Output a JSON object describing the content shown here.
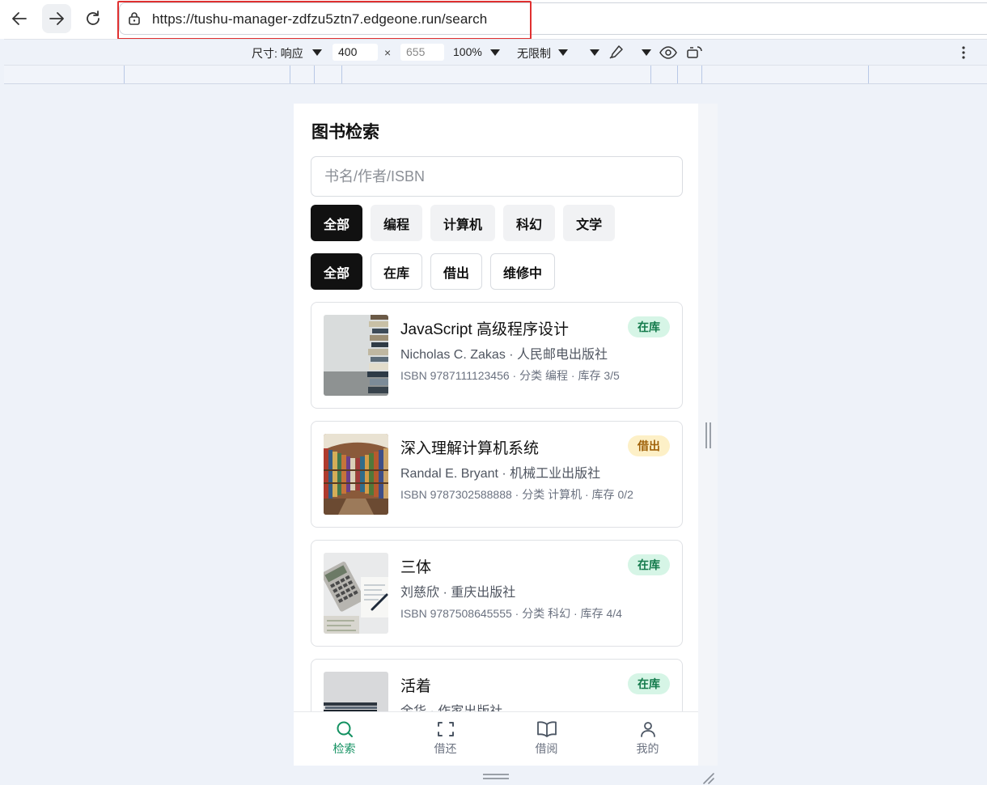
{
  "browser": {
    "url": "https://tushu-manager-zdfzu5ztn7.edgeone.run/search",
    "device_toolbar": {
      "size_label": "尺寸: 响应",
      "width": "400",
      "times": "×",
      "height": "655",
      "zoom": "100%",
      "throttle": "无限制"
    }
  },
  "page": {
    "title": "图书检索",
    "search_placeholder": "书名/作者/ISBN",
    "categories": [
      "全部",
      "编程",
      "计算机",
      "科幻",
      "文学"
    ],
    "active_category": "全部",
    "statuses": [
      "全部",
      "在库",
      "借出",
      "维修中"
    ],
    "active_status": "全部"
  },
  "books": [
    {
      "title": "JavaScript 高级程序设计",
      "subtitle": "Nicholas C. Zakas · 人民邮电出版社",
      "meta": "ISBN 9787111123456 · 分类 编程 · 库存 3/5",
      "status": "在库",
      "status_color": "#137a4b"
    },
    {
      "title": "深入理解计算机系统",
      "subtitle": "Randal E. Bryant · 机械工业出版社",
      "meta": "ISBN 9787302588888 · 分类 计算机 · 库存 0/2",
      "status": "借出",
      "status_color": "#a0620a"
    },
    {
      "title": "三体",
      "subtitle": "刘慈欣 · 重庆出版社",
      "meta": "ISBN 9787508645555 · 分类 科幻 · 库存 4/4",
      "status": "在库",
      "status_color": "#137a4b"
    },
    {
      "title": "活着",
      "subtitle": "余华 · 作家出版社",
      "meta": "",
      "status": "在库",
      "status_color": "#137a4b"
    }
  ],
  "tabs": [
    {
      "label": "检索",
      "icon": "search-icon",
      "active": true
    },
    {
      "label": "借还",
      "icon": "scan-icon",
      "active": false
    },
    {
      "label": "借阅",
      "icon": "book-open-icon",
      "active": false
    },
    {
      "label": "我的",
      "icon": "user-icon",
      "active": false
    }
  ],
  "colors": {
    "accent_green": "#139161",
    "chip_active": "#111111",
    "badge_green_bg": "#d6f5e6",
    "badge_amber_bg": "#fdf0c7"
  }
}
